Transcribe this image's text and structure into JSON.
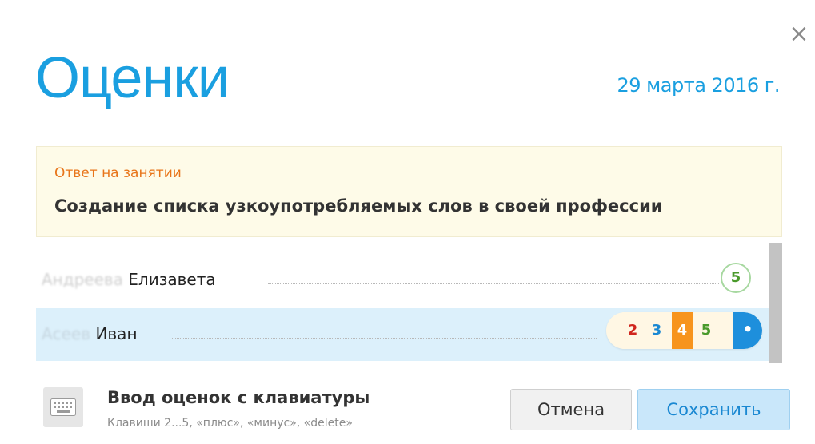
{
  "dialog": {
    "title": "Оценки",
    "date": "29 марта 2016 г.",
    "close_label": "×"
  },
  "lesson": {
    "type": "Ответ на занятии",
    "topic": "Создание списка узкоупотребляемых слов в своей профессии"
  },
  "students": [
    {
      "name_hidden": "Андреева",
      "first_name": "Елизавета",
      "grade": "5"
    },
    {
      "name_hidden": "Асеев",
      "first_name": "Иван",
      "grade_options": [
        {
          "label": "2",
          "color": "#d0261e",
          "bg": "#fff7e4"
        },
        {
          "label": "3",
          "color": "#1a88d2",
          "bg": "#fff7e4"
        },
        {
          "label": "4",
          "color": "#ffffff",
          "bg": "#f7941d"
        },
        {
          "label": "5",
          "color": "#4a9a2b",
          "bg": "#fff7e4"
        }
      ],
      "dot_label": "•"
    }
  ],
  "keyboard": {
    "title": "Ввод оценок с клавиатуры",
    "hint": "Клавиши 2...5, «плюс», «минус», «delete»",
    "icon": "keyboard-icon"
  },
  "buttons": {
    "cancel": "Отмена",
    "save": "Сохранить"
  },
  "colors": {
    "accent": "#1a9fe0",
    "lesson_type": "#e8751a",
    "selected_row": "#dcf0fb"
  }
}
